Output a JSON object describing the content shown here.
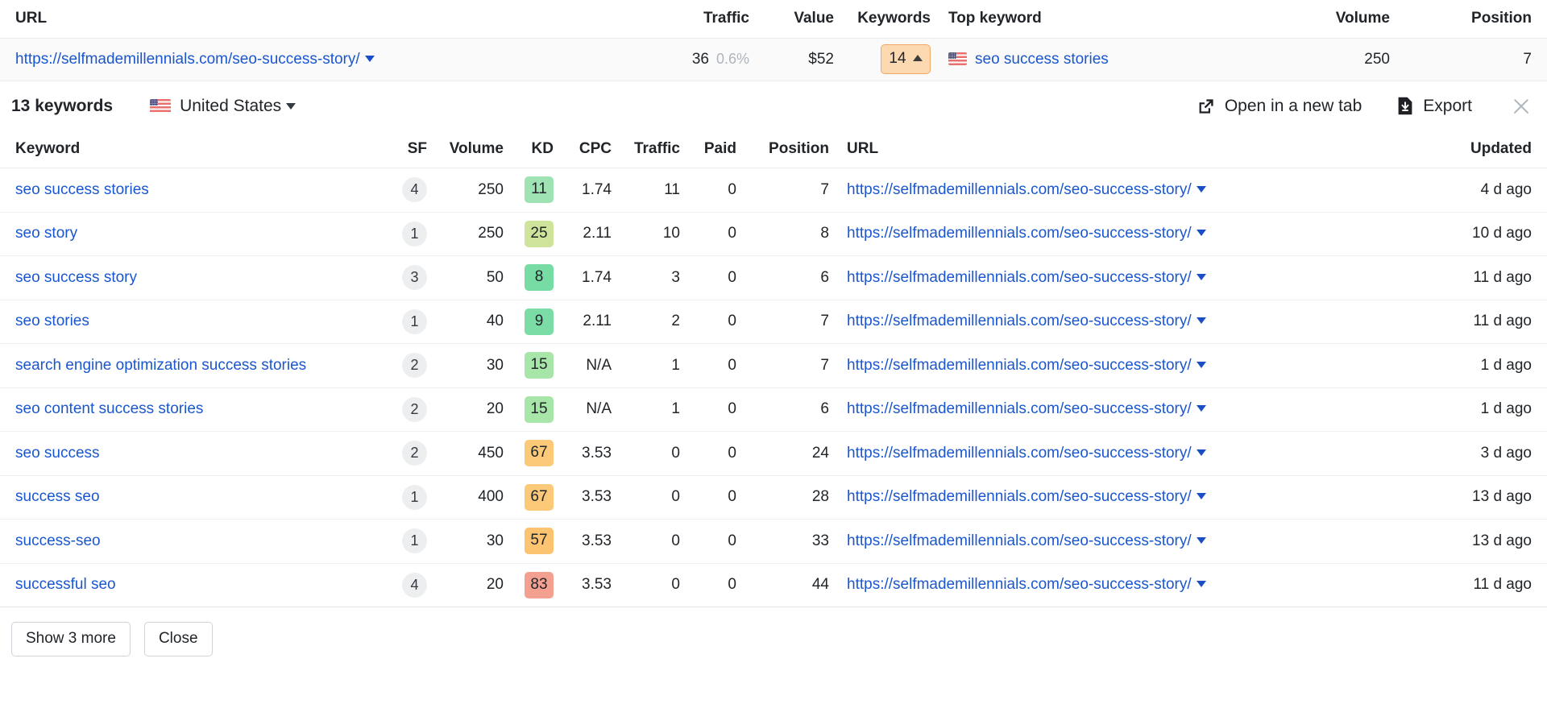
{
  "outer_table": {
    "columns": [
      {
        "key": "url",
        "label": "URL"
      },
      {
        "key": "traffic",
        "label": "Traffic"
      },
      {
        "key": "value",
        "label": "Value"
      },
      {
        "key": "keywords",
        "label": "Keywords"
      },
      {
        "key": "top_keyword",
        "label": "Top keyword"
      },
      {
        "key": "volume",
        "label": "Volume"
      },
      {
        "key": "position",
        "label": "Position"
      }
    ],
    "row": {
      "url": "https://selfmademillennials.com/seo-success-story/",
      "traffic": "36",
      "traffic_pct": "0.6%",
      "value": "$52",
      "keywords_badge": "14",
      "keywords_trend_icon": "caret-up-icon",
      "top_keyword": "seo success stories",
      "top_keyword_flag": "us-flag-icon",
      "volume": "250",
      "position": "7"
    }
  },
  "toolbar": {
    "title": "13 keywords",
    "country": "United States",
    "country_flag_icon": "us-flag-icon",
    "open_new_tab_label": "Open in a new tab",
    "open_new_tab_icon": "external-link-icon",
    "export_label": "Export",
    "export_icon": "download-file-icon",
    "close_icon": "close-icon"
  },
  "keyword_table": {
    "columns": [
      {
        "key": "keyword",
        "label": "Keyword",
        "align": "left"
      },
      {
        "key": "sf",
        "label": "SF",
        "align": "right"
      },
      {
        "key": "volume",
        "label": "Volume",
        "align": "right"
      },
      {
        "key": "kd",
        "label": "KD",
        "align": "right"
      },
      {
        "key": "cpc",
        "label": "CPC",
        "align": "right"
      },
      {
        "key": "traffic",
        "label": "Traffic",
        "align": "right"
      },
      {
        "key": "paid",
        "label": "Paid",
        "align": "right"
      },
      {
        "key": "position",
        "label": "Position",
        "align": "right"
      },
      {
        "key": "url",
        "label": "URL",
        "align": "left"
      },
      {
        "key": "updated",
        "label": "Updated",
        "align": "right"
      }
    ],
    "rows": [
      {
        "keyword": "seo success stories",
        "sf": "4",
        "volume": "250",
        "kd": "11",
        "kd_color": "#9fe3b5",
        "cpc": "1.74",
        "cpc_na": false,
        "traffic": "11",
        "traffic_zero": false,
        "paid": "0",
        "position": "7",
        "url": "https://selfmademillennials.com/seo-success-story/",
        "updated": "4 d ago"
      },
      {
        "keyword": "seo story",
        "sf": "1",
        "volume": "250",
        "kd": "25",
        "kd_color": "#cfe49b",
        "cpc": "2.11",
        "cpc_na": false,
        "traffic": "10",
        "traffic_zero": false,
        "paid": "0",
        "position": "8",
        "url": "https://selfmademillennials.com/seo-success-story/",
        "updated": "10 d ago"
      },
      {
        "keyword": "seo success story",
        "sf": "3",
        "volume": "50",
        "kd": "8",
        "kd_color": "#77dba4",
        "cpc": "1.74",
        "cpc_na": false,
        "traffic": "3",
        "traffic_zero": false,
        "paid": "0",
        "position": "6",
        "url": "https://selfmademillennials.com/seo-success-story/",
        "updated": "11 d ago"
      },
      {
        "keyword": "seo stories",
        "sf": "1",
        "volume": "40",
        "kd": "9",
        "kd_color": "#7bdca6",
        "cpc": "2.11",
        "cpc_na": false,
        "traffic": "2",
        "traffic_zero": false,
        "paid": "0",
        "position": "7",
        "url": "https://selfmademillennials.com/seo-success-story/",
        "updated": "11 d ago"
      },
      {
        "keyword": "search engine optimization success stories",
        "sf": "2",
        "volume": "30",
        "kd": "15",
        "kd_color": "#a8e5a9",
        "cpc": "N/A",
        "cpc_na": true,
        "traffic": "1",
        "traffic_zero": false,
        "paid": "0",
        "position": "7",
        "url": "https://selfmademillennials.com/seo-success-story/",
        "updated": "1 d ago"
      },
      {
        "keyword": "seo content success stories",
        "sf": "2",
        "volume": "20",
        "kd": "15",
        "kd_color": "#a8e5a9",
        "cpc": "N/A",
        "cpc_na": true,
        "traffic": "1",
        "traffic_zero": false,
        "paid": "0",
        "position": "6",
        "url": "https://selfmademillennials.com/seo-success-story/",
        "updated": "1 d ago"
      },
      {
        "keyword": "seo success",
        "sf": "2",
        "volume": "450",
        "kd": "67",
        "kd_color": "#fcc978",
        "cpc": "3.53",
        "cpc_na": false,
        "traffic": "0",
        "traffic_zero": true,
        "paid": "0",
        "position": "24",
        "url": "https://selfmademillennials.com/seo-success-story/",
        "updated": "3 d ago"
      },
      {
        "keyword": "success seo",
        "sf": "1",
        "volume": "400",
        "kd": "67",
        "kd_color": "#fcc978",
        "cpc": "3.53",
        "cpc_na": false,
        "traffic": "0",
        "traffic_zero": true,
        "paid": "0",
        "position": "28",
        "url": "https://selfmademillennials.com/seo-success-story/",
        "updated": "13 d ago"
      },
      {
        "keyword": "success-seo",
        "sf": "1",
        "volume": "30",
        "kd": "57",
        "kd_color": "#fcc371",
        "cpc": "3.53",
        "cpc_na": false,
        "traffic": "0",
        "traffic_zero": true,
        "paid": "0",
        "position": "33",
        "url": "https://selfmademillennials.com/seo-success-story/",
        "updated": "13 d ago"
      },
      {
        "keyword": "successful seo",
        "sf": "4",
        "volume": "20",
        "kd": "83",
        "kd_color": "#f4a090",
        "cpc": "3.53",
        "cpc_na": false,
        "traffic": "0",
        "traffic_zero": true,
        "paid": "0",
        "position": "44",
        "url": "https://selfmademillennials.com/seo-success-story/",
        "updated": "11 d ago"
      }
    ]
  },
  "footer": {
    "show_more_label": "Show 3 more",
    "close_label": "Close"
  },
  "colors": {
    "link": "#1a57cf",
    "keywords_badge_bg": "#fcd9b0",
    "keywords_badge_border": "#f0a868",
    "muted": "#ced4da",
    "row_highlight": "#fafafa"
  }
}
